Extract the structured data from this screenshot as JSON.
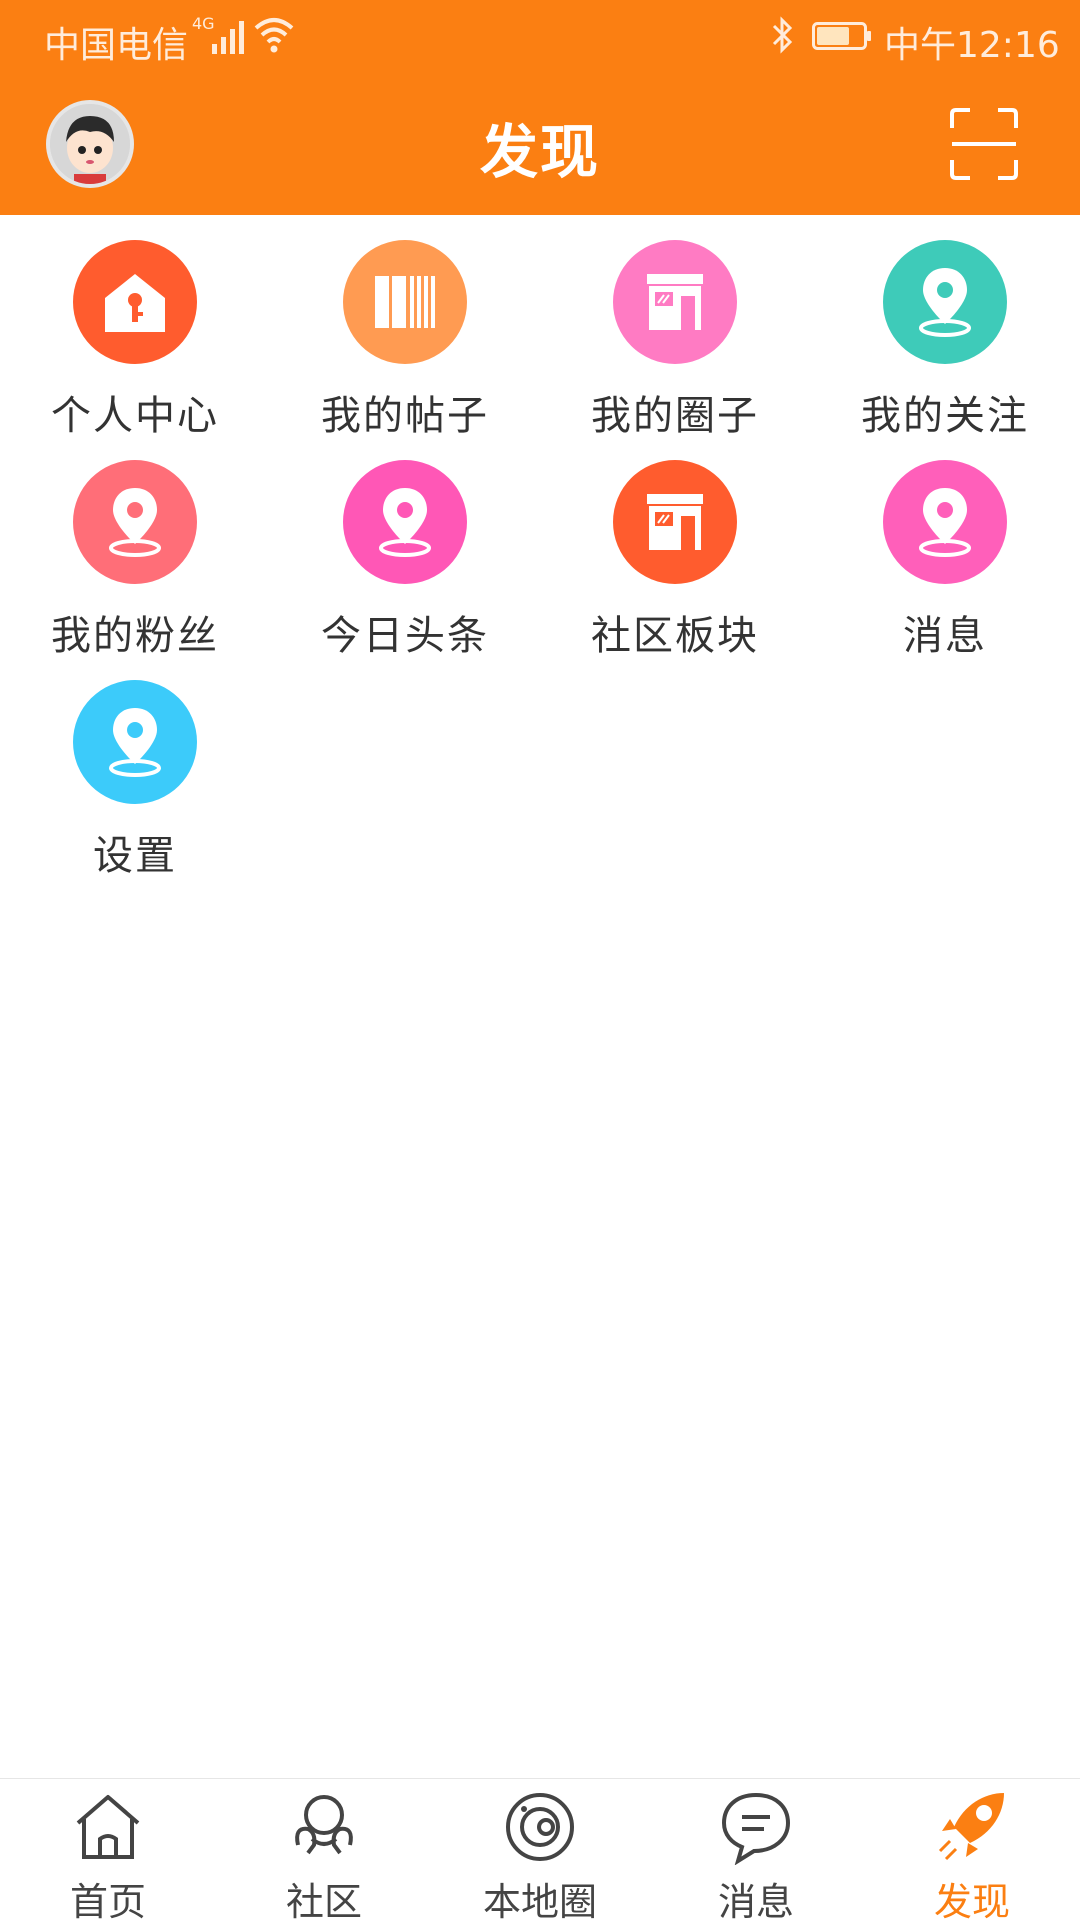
{
  "status_bar": {
    "carrier": "中国电信",
    "network": "4G",
    "time": "中午12:16"
  },
  "header": {
    "title": "发现"
  },
  "colors": {
    "brand": "#FB7F12",
    "active_tab": "#FB7F12"
  },
  "grid": {
    "items": [
      {
        "label": "个人中心",
        "icon": "house-key-icon",
        "color": "#FF5C2E"
      },
      {
        "label": "我的帖子",
        "icon": "books-icon",
        "color": "#FF9B52"
      },
      {
        "label": "我的圈子",
        "icon": "shop-icon",
        "color": "#FF7BC3"
      },
      {
        "label": "我的关注",
        "icon": "location-pin-icon",
        "color": "#3ECBB9"
      },
      {
        "label": "我的粉丝",
        "icon": "location-pin-icon",
        "color": "#FF6E78"
      },
      {
        "label": "今日头条",
        "icon": "location-pin-icon",
        "color": "#FF57B6"
      },
      {
        "label": "社区板块",
        "icon": "shop-icon",
        "color": "#FF5C2E"
      },
      {
        "label": "消息",
        "icon": "location-pin-icon",
        "color": "#FF5FBA"
      },
      {
        "label": "设置",
        "icon": "location-pin-icon",
        "color": "#3CCBFA"
      }
    ]
  },
  "bottom_nav": {
    "tabs": [
      {
        "label": "首页",
        "icon": "home-icon"
      },
      {
        "label": "社区",
        "icon": "community-icon"
      },
      {
        "label": "本地圈",
        "icon": "local-circle-icon"
      },
      {
        "label": "消息",
        "icon": "message-icon"
      },
      {
        "label": "发现",
        "icon": "rocket-icon",
        "active": true
      }
    ]
  }
}
